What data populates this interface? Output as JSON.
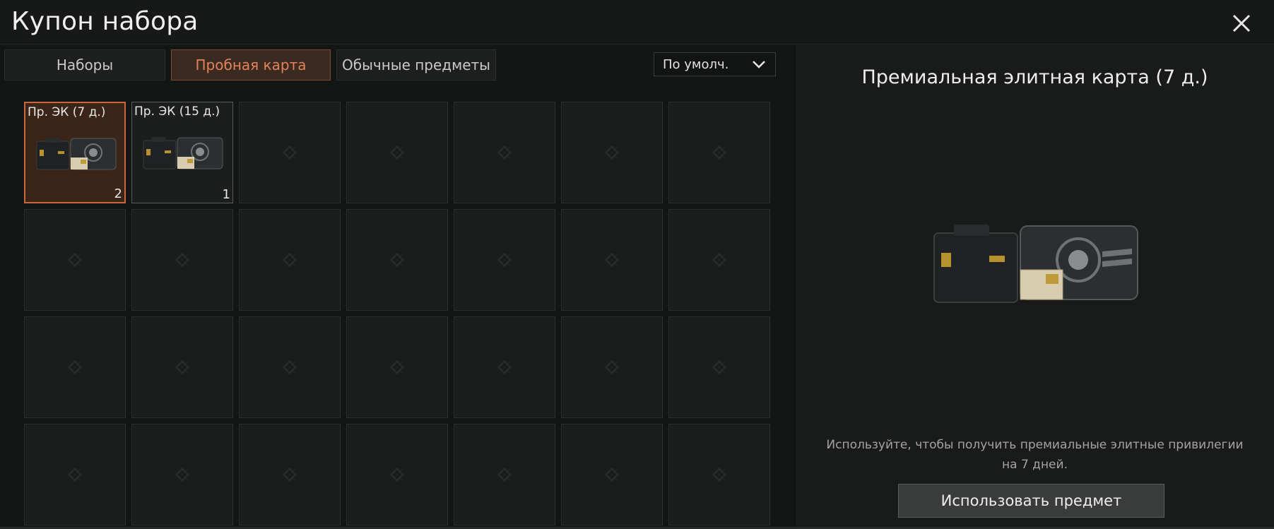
{
  "window": {
    "title": "Купон набора",
    "close_icon": "close-icon"
  },
  "tabs": [
    {
      "label": "Наборы",
      "active": false
    },
    {
      "label": "Пробная карта",
      "active": true
    },
    {
      "label": "Обычные предметы",
      "active": false
    }
  ],
  "sort": {
    "selected": "По умолч.",
    "icon": "chevron-down-icon"
  },
  "grid": {
    "columns": 7,
    "rows": 4,
    "items": [
      {
        "label": "Пр. ЭК (7 д.)",
        "count": "2",
        "selected": true,
        "icon": "elite-card-case-icon"
      },
      {
        "label": "Пр. ЭК (15 д.)",
        "count": "1",
        "selected": false,
        "icon": "elite-card-case-icon"
      }
    ]
  },
  "detail": {
    "title": "Премиальная элитная карта (7 д.)",
    "image": "elite-card-case-icon",
    "description": "Используйте, чтобы получить премиальные элитные привилегии на 7 дней.",
    "use_button": "Использовать предмет"
  },
  "colors": {
    "accent": "#c9663e",
    "accent_text": "#e2835a",
    "background": "#171918"
  }
}
